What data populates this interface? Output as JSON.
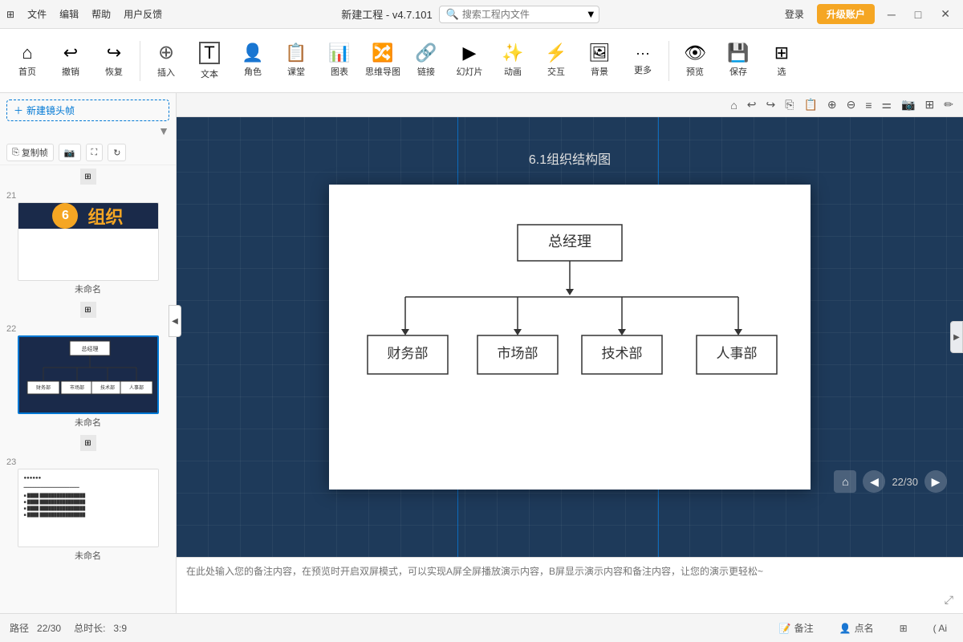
{
  "titlebar": {
    "menu_items": [
      "文件",
      "编辑",
      "帮助",
      "用户反馈"
    ],
    "title": "新建工程 - v4.7.101",
    "search_placeholder": "搜索工程内文件",
    "login_label": "登录",
    "upgrade_label": "升级账户",
    "controls": [
      "─",
      "□",
      "✕"
    ]
  },
  "toolbar": {
    "items": [
      {
        "id": "home",
        "icon": "⌂",
        "label": "首页"
      },
      {
        "id": "undo",
        "icon": "↩",
        "label": "撤销"
      },
      {
        "id": "redo",
        "icon": "↪",
        "label": "恢复"
      },
      {
        "id": "insert",
        "icon": "⊕",
        "label": "插入"
      },
      {
        "id": "text",
        "icon": "T",
        "label": "文本"
      },
      {
        "id": "role",
        "icon": "👤",
        "label": "角色"
      },
      {
        "id": "class",
        "icon": "📋",
        "label": "课堂"
      },
      {
        "id": "chart",
        "icon": "📊",
        "label": "图表"
      },
      {
        "id": "mindmap",
        "icon": "🔀",
        "label": "思维导图"
      },
      {
        "id": "link",
        "icon": "🔗",
        "label": "链接"
      },
      {
        "id": "slide",
        "icon": "▶",
        "label": "幻灯片"
      },
      {
        "id": "animate",
        "icon": "✨",
        "label": "动画"
      },
      {
        "id": "interact",
        "icon": "⚡",
        "label": "交互"
      },
      {
        "id": "bg",
        "icon": "🖼",
        "label": "背景"
      },
      {
        "id": "more",
        "icon": "···",
        "label": "更多"
      },
      {
        "id": "preview",
        "icon": "👁",
        "label": "预览"
      },
      {
        "id": "save",
        "icon": "💾",
        "label": "保存"
      },
      {
        "id": "select",
        "icon": "⊞",
        "label": "选"
      }
    ]
  },
  "sidebar": {
    "new_frame_label": "新建镜头帧",
    "copy_frame_label": "复制帧",
    "slides": [
      {
        "num": 21,
        "name": "未命名",
        "type": "orange",
        "circle_num": "6",
        "text": "组织"
      },
      {
        "num": 22,
        "name": "未命名",
        "type": "orgchart",
        "active": true
      },
      {
        "num": 23,
        "name": "未命名",
        "type": "text"
      }
    ]
  },
  "canvas": {
    "slide_title": "6.1组织结构图",
    "org_chart": {
      "root": "总经理",
      "children": [
        "财务部",
        "市场部",
        "技术部",
        "人事部"
      ]
    },
    "slide_num_label": "22",
    "page_nav": {
      "current": 22,
      "total": 30,
      "display": "22/30"
    }
  },
  "notes": {
    "placeholder": "在此处输入您的备注内容，在预览时开启双屏模式，可以实现A屏全屏播放演示内容，B屏显示演示内容和备注内容，让您的演示更轻松~"
  },
  "statusbar": {
    "path_label": "路径",
    "path_value": "22/30",
    "total_label": "总时长:",
    "total_value": "3:9",
    "notes_btn": "备注",
    "roll_call_btn": "点名",
    "ai_label": "( Ai"
  }
}
